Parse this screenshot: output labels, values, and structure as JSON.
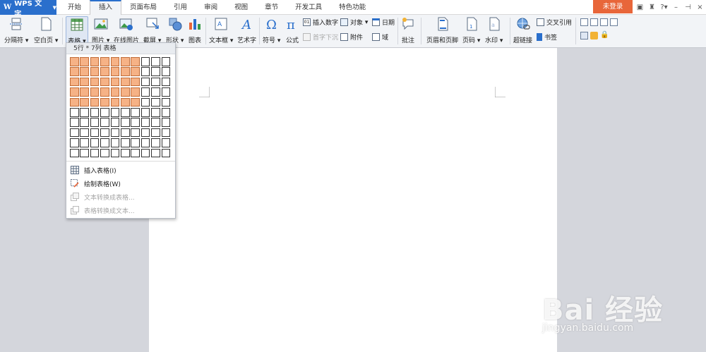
{
  "app": {
    "logo_label": "WPS 文字"
  },
  "tabs": [
    {
      "label": "开始"
    },
    {
      "label": "插入"
    },
    {
      "label": "页面布局"
    },
    {
      "label": "引用"
    },
    {
      "label": "审阅"
    },
    {
      "label": "视图"
    },
    {
      "label": "章节"
    },
    {
      "label": "开发工具"
    },
    {
      "label": "特色功能"
    }
  ],
  "active_tab": "插入",
  "login_label": "未登录",
  "ribbon": {
    "page_break": "分隔符",
    "blank_page": "空白页",
    "table": "表格",
    "picture": "图片",
    "online_picture": "在线图片",
    "screenshot": "截屏",
    "shapes": "形状",
    "chart": "图表",
    "textbox": "文本框",
    "wordart": "艺术字",
    "symbol": "符号",
    "formula": "公式",
    "insert_number": "插入数字",
    "drop_cap": "首字下沉",
    "object": "对象",
    "attachment": "附件",
    "date": "日期",
    "field": "域",
    "comment": "批注",
    "header_footer": "页眉和页脚",
    "page_number": "页码",
    "watermark": "水印",
    "hyperlink": "超链接",
    "cross_reference": "交叉引用",
    "bookmark": "书签"
  },
  "table_menu": {
    "header": "5行 * 7列 表格",
    "rows_selected": 5,
    "cols_selected": 7,
    "grid_rows": 10,
    "grid_cols": 10,
    "insert_table": "插入表格(I)",
    "draw_table": "绘制表格(W)",
    "text_to_table": "文本转换成表格...",
    "table_to_text": "表格转换成文本..."
  },
  "watermark_overlay": {
    "brand": "Bai 经验",
    "url": "jingyan.baidu.com"
  },
  "colors": {
    "accent": "#2a6fcc",
    "login": "#e8663a",
    "selected_cell": "#f6b286"
  }
}
